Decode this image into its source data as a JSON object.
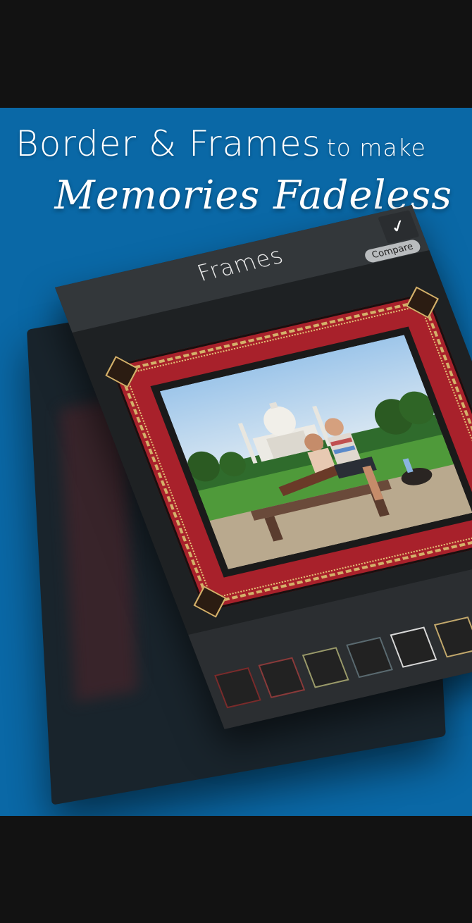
{
  "promo": {
    "headline_big": "Border & Frames",
    "headline_small": "to make",
    "headline_script": "Memories Fadeless"
  },
  "app": {
    "title": "Frames",
    "confirm_icon": "checkmark-icon",
    "compare_label": "Compare"
  },
  "colors": {
    "background_blue": "#0a68a6",
    "frame_red": "#a8212b",
    "frame_gold": "#d4b16a"
  },
  "thumbnails": [
    {
      "name": "frame-thumb-1",
      "border": "#7a2b2b"
    },
    {
      "name": "frame-thumb-2",
      "border": "#8a3a3a"
    },
    {
      "name": "frame-thumb-3",
      "border": "#9a9a6a"
    },
    {
      "name": "frame-thumb-4",
      "border": "#5a6a70"
    },
    {
      "name": "frame-thumb-5",
      "border": "#d8d8d8"
    },
    {
      "name": "frame-thumb-6",
      "border": "#c2a86c"
    },
    {
      "name": "frame-thumb-7",
      "border": "#9a8050"
    }
  ]
}
